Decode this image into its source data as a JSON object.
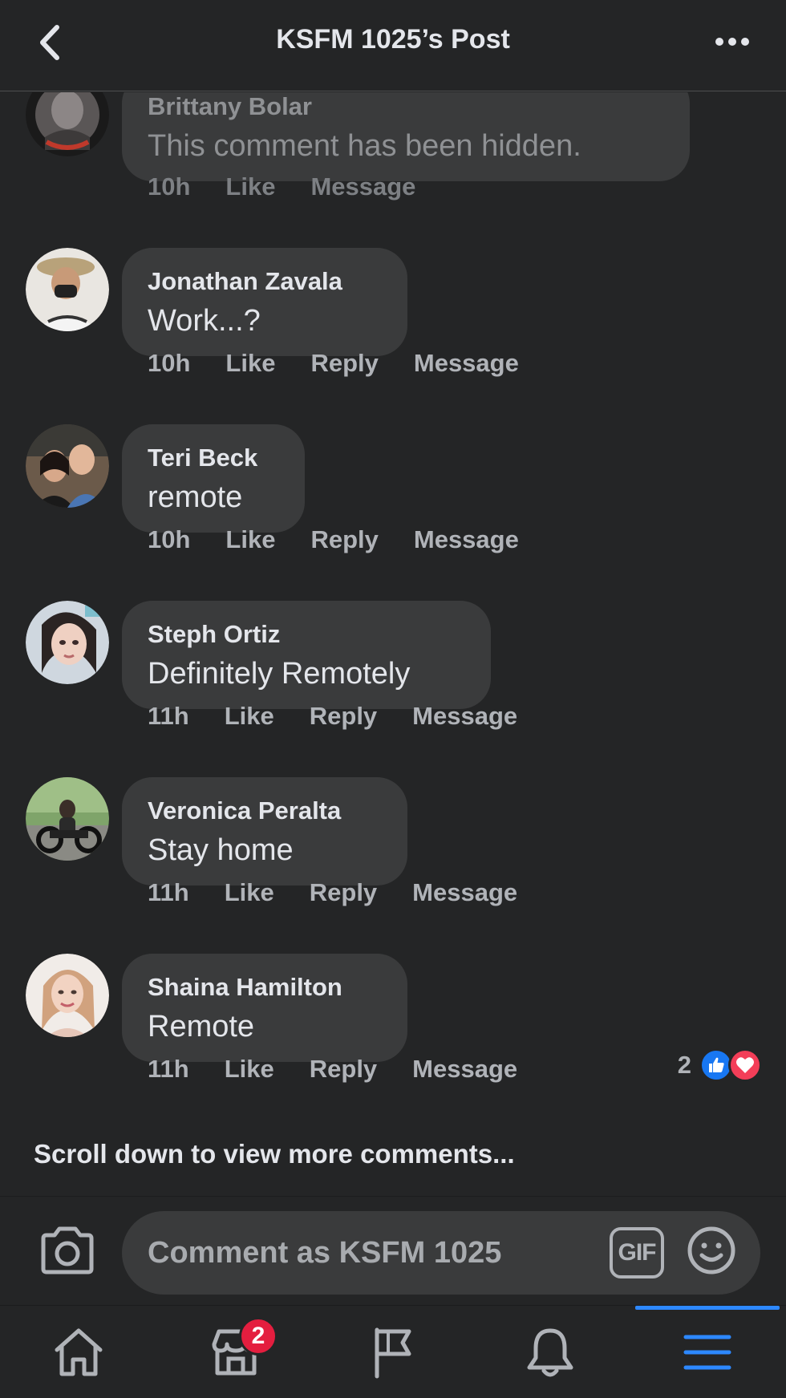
{
  "header": {
    "title": "KSFM 1025’s Post"
  },
  "comments": [
    {
      "author": "Brittany Bolar",
      "text": "This comment has been hidden.",
      "time": "10h",
      "like": "Like",
      "message": "Message",
      "hidden": true
    },
    {
      "author": "Jonathan Zavala",
      "text": "Work...?",
      "time": "10h",
      "like": "Like",
      "reply": "Reply",
      "message": "Message"
    },
    {
      "author": "Teri Beck",
      "text": "remote",
      "time": "10h",
      "like": "Like",
      "reply": "Reply",
      "message": "Message"
    },
    {
      "author": "Steph Ortiz",
      "text": "Definitely Remotely",
      "time": "11h",
      "like": "Like",
      "reply": "Reply",
      "message": "Message"
    },
    {
      "author": "Veronica Peralta",
      "text": "Stay home",
      "time": "11h",
      "like": "Like",
      "reply": "Reply",
      "message": "Message"
    },
    {
      "author": "Shaina Hamilton",
      "text": "Remote",
      "time": "11h",
      "like": "Like",
      "reply": "Reply",
      "message": "Message",
      "reaction_count": "2",
      "reactions": [
        "like-icon",
        "love-icon"
      ]
    }
  ],
  "scroll_more": "Scroll down to view more comments...",
  "composer": {
    "placeholder": "Comment as KSFM 1025",
    "gif_label": "GIF"
  },
  "bottom_nav": {
    "items": [
      "home-icon",
      "marketplace-icon",
      "pages-icon",
      "notifications-icon",
      "menu-icon"
    ],
    "marketplace_badge": "2",
    "active": "menu"
  },
  "colors": {
    "background": "#242526",
    "bubble": "#3a3b3c",
    "accent": "#2d88ff",
    "badge": "#e41e3f",
    "like": "#1877f2",
    "love": "#f33e58"
  }
}
